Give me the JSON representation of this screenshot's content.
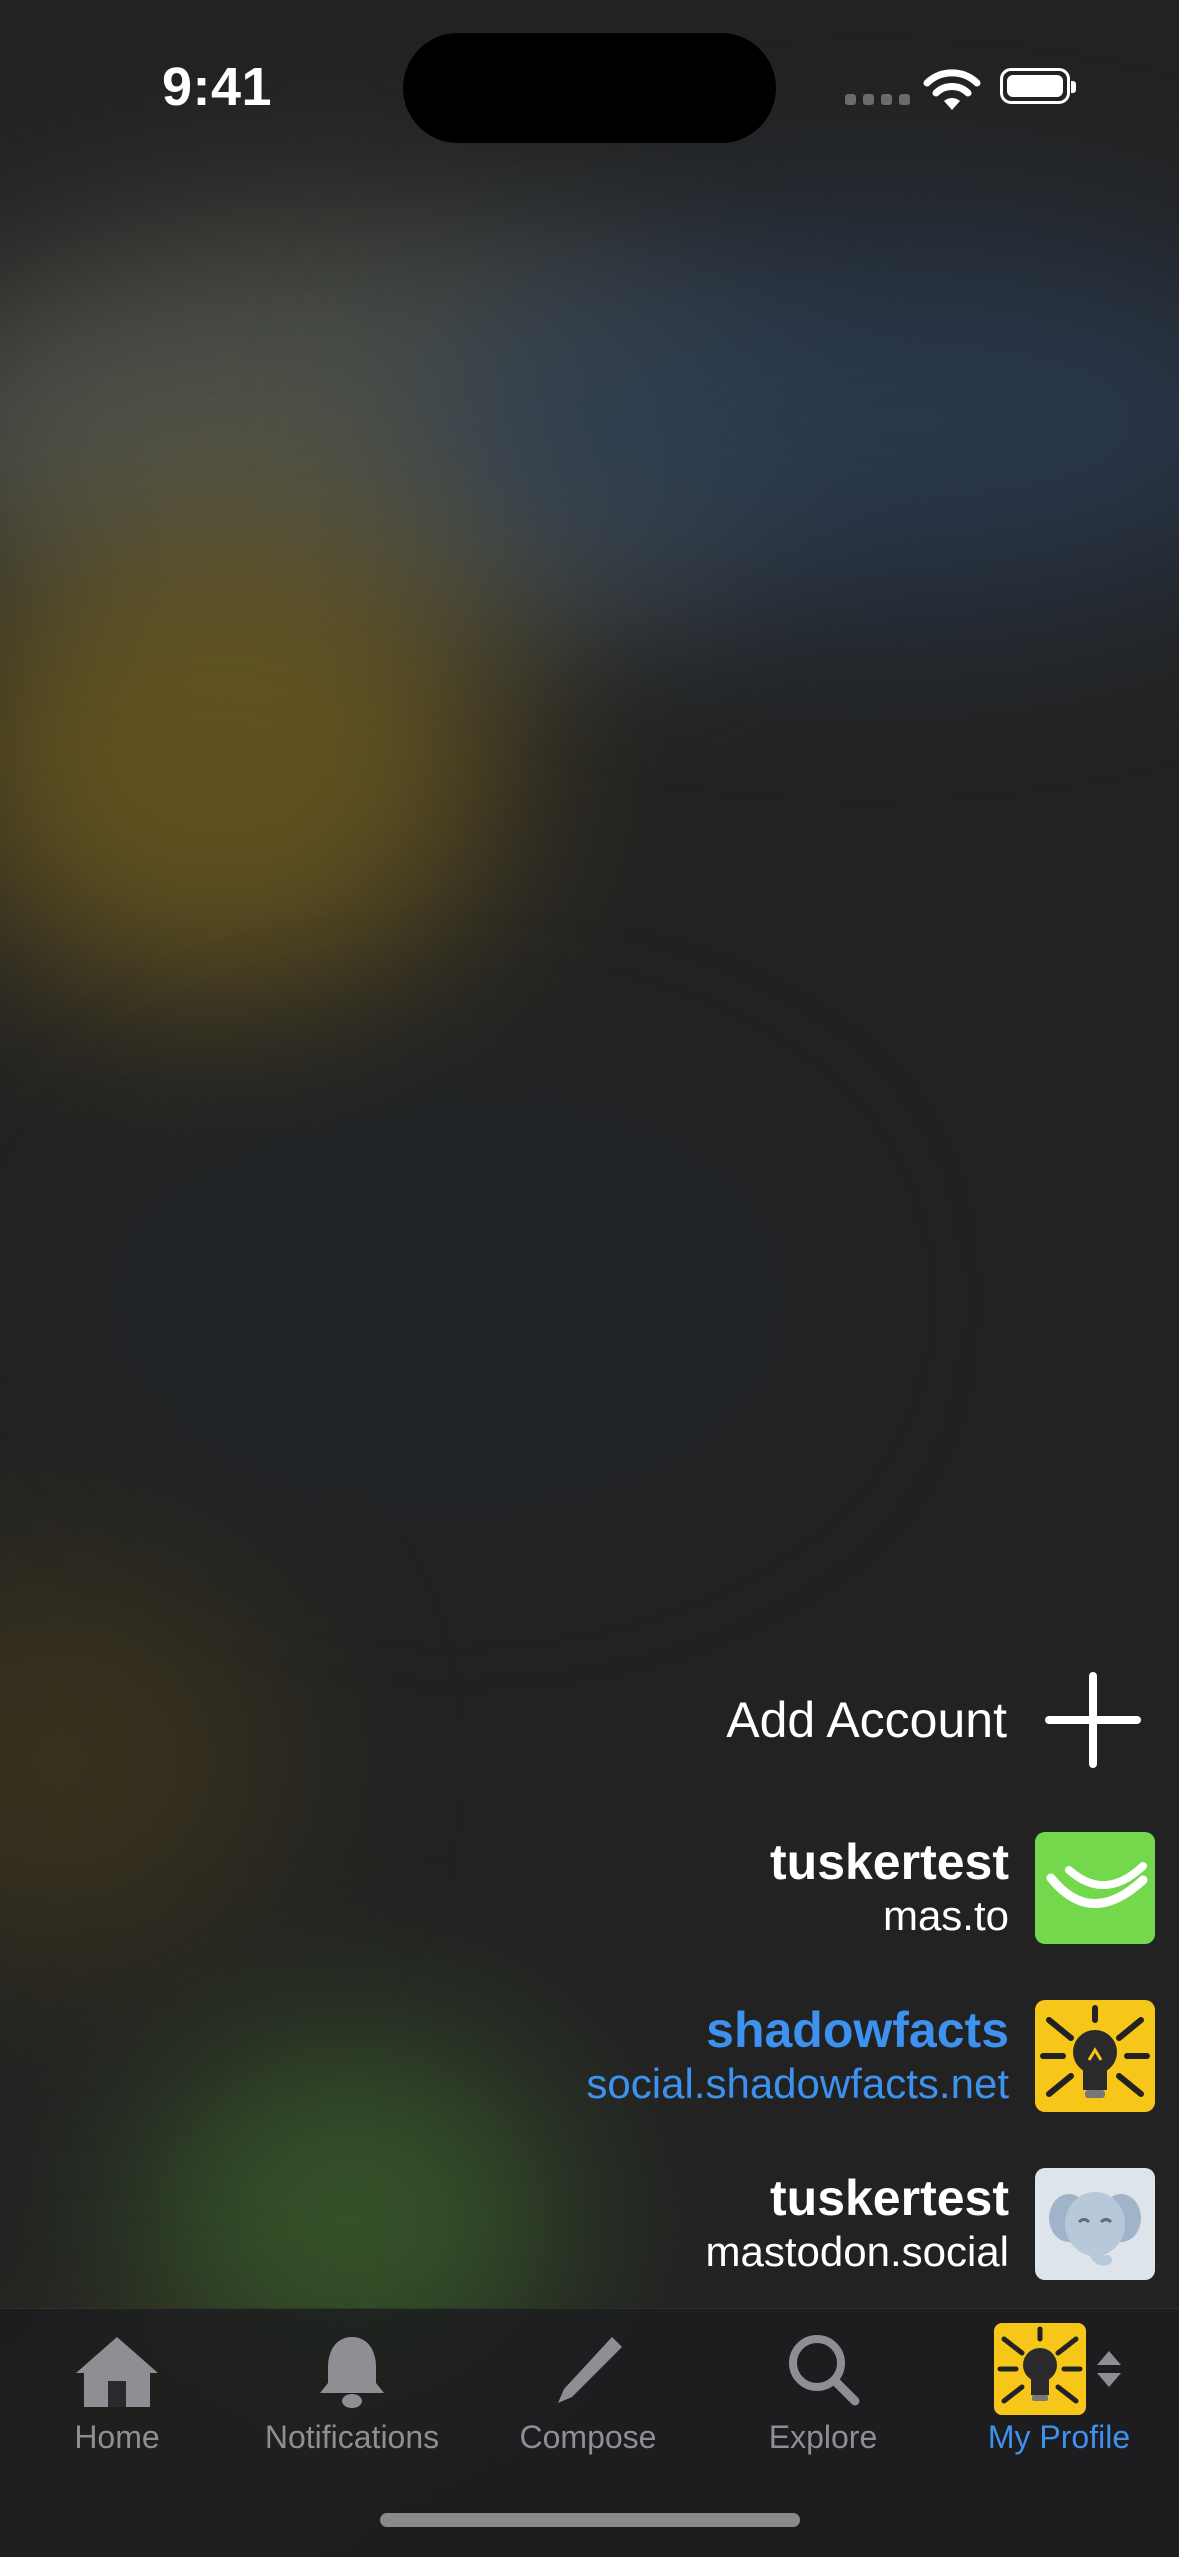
{
  "status_bar": {
    "time": "9:41"
  },
  "account_switcher": {
    "add_account_label": "Add Account",
    "accounts": [
      {
        "username": "tuskertest",
        "instance": "mas.to",
        "active": false,
        "avatar": "green-logo"
      },
      {
        "username": "shadowfacts",
        "instance": "social.shadowfacts.net",
        "active": true,
        "avatar": "lightbulb"
      },
      {
        "username": "tuskertest",
        "instance": "mastodon.social",
        "active": false,
        "avatar": "elephant"
      }
    ]
  },
  "tab_bar": {
    "tabs": [
      {
        "label": "Home",
        "icon": "house-icon"
      },
      {
        "label": "Notifications",
        "icon": "bell-icon"
      },
      {
        "label": "Compose",
        "icon": "pencil-icon"
      },
      {
        "label": "Explore",
        "icon": "magnifier-icon"
      },
      {
        "label": "My Profile",
        "icon": "profile-avatar",
        "active": true
      }
    ]
  },
  "colors": {
    "accent": "#3d91ef",
    "tab_inactive": "#8e8e93",
    "background": "#222222"
  }
}
